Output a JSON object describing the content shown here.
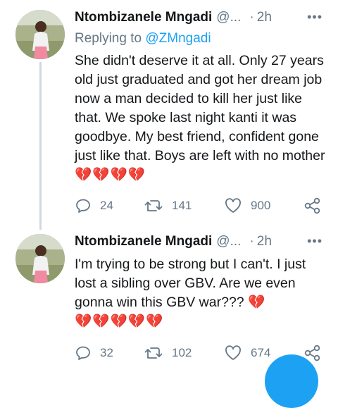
{
  "tweets": [
    {
      "name": "Ntombizanele Mngadi",
      "handle": "@...",
      "separator": "·",
      "time": "2h",
      "more": "•••",
      "replying_prefix": "Replying to",
      "replying_to": "@ZMngadi",
      "text": "She didn't deserve it at all. Only 27 years old just graduated and got her dream job now a man decided to kill her just like that. We spoke last night kanti it was goodbye. My best friend, confident gone just like that. Boys are left with no mother",
      "hearts": "💔💔💔💔",
      "replies": "24",
      "retweets": "141",
      "likes": "900"
    },
    {
      "name": "Ntombizanele Mngadi",
      "handle": "@...",
      "separator": "·",
      "time": "2h",
      "more": "•••",
      "text": "I'm trying to be strong but I can't. I just lost a sibling over GBV. Are we even gonna win this GBV war???",
      "hearts_inline": "💔",
      "hearts_line": "💔💔💔💔💔",
      "replies": "32",
      "retweets": "102",
      "likes": "674"
    }
  ],
  "icons": {
    "reply": "reply-icon",
    "retweet": "retweet-icon",
    "like": "like-icon",
    "share": "share-icon",
    "more": "more-icon"
  },
  "colors": {
    "text": "#14171a",
    "secondary": "#657786",
    "link": "#1da1f2",
    "heart": "#e0245e",
    "accent": "#1da1f2"
  }
}
